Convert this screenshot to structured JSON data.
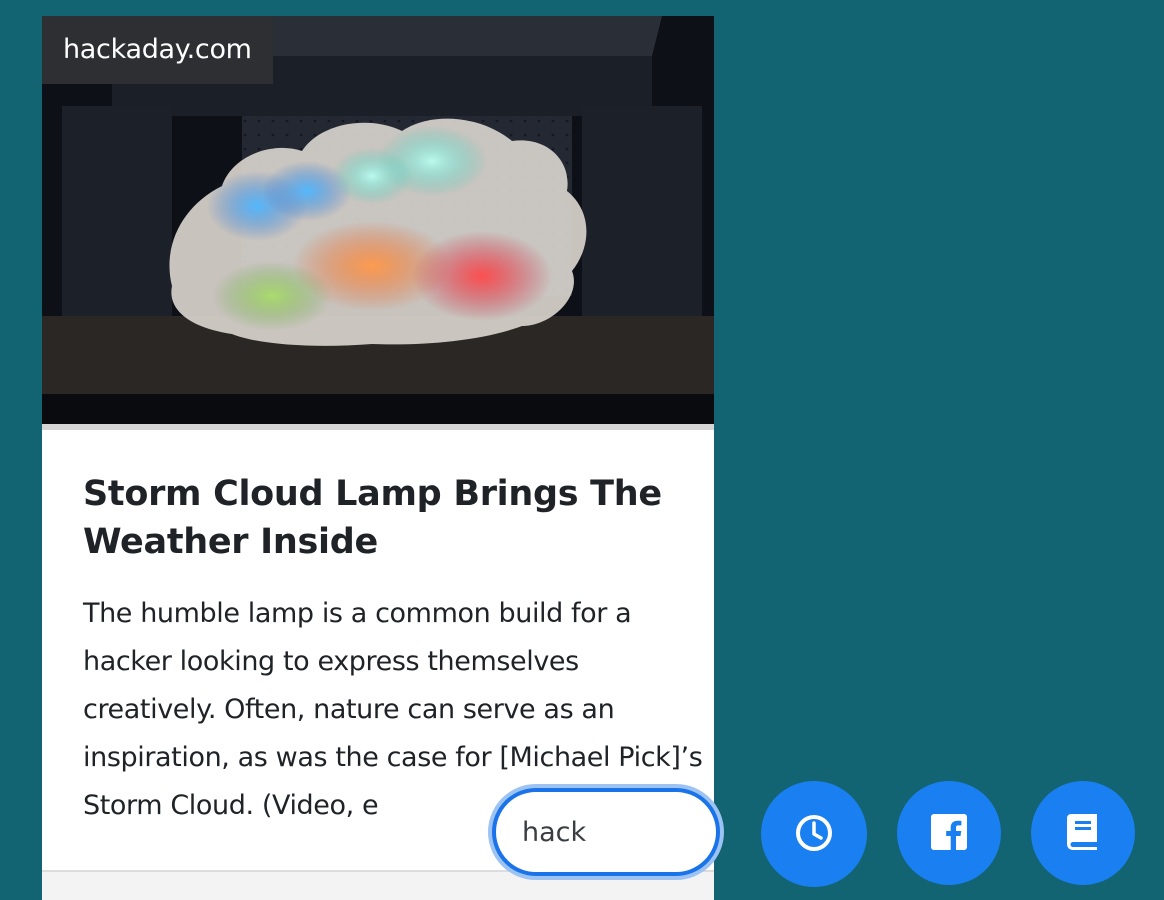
{
  "card": {
    "source": "hackaday.com",
    "title": "Storm Cloud Lamp Brings The Weather Inside",
    "excerpt": "The humble lamp is a common build for a hacker looking to express themselves creatively. Often, nature can serve as an inspiration, as was the case for [Michael Pick]’s Storm Cloud. (Video, e"
  },
  "search": {
    "value": "hack"
  },
  "actions": [
    {
      "name": "history",
      "icon": "clock-icon"
    },
    {
      "name": "facebook",
      "icon": "facebook-icon"
    },
    {
      "name": "reading-list",
      "icon": "book-icon"
    }
  ],
  "colors": {
    "background": "#136472",
    "accent": "#1a7ff0",
    "search_border": "#1a73e8"
  }
}
